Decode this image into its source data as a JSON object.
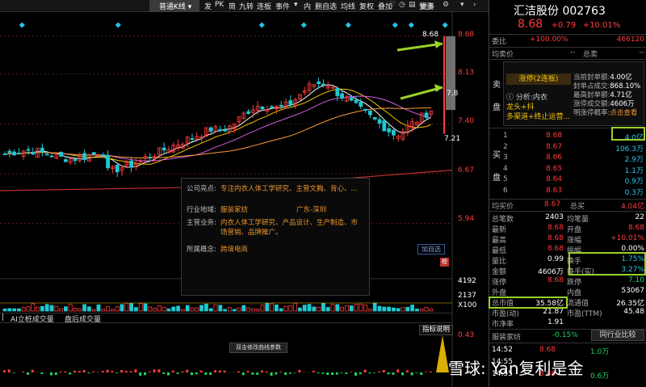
{
  "toolbar": {
    "kline_type": "普通K线",
    "items": [
      "发",
      "PK",
      "简",
      "九转",
      "连板",
      "事件",
      "▾",
      "内",
      "删自选",
      "均线",
      "复权",
      "叠加"
    ],
    "more": "更多",
    "icons": [
      "heart-icon",
      "clock-icon",
      "chart-icon",
      "edit-icon",
      "calendar-icon",
      "grid-icon"
    ]
  },
  "price_axis": [
    "8.68",
    "8.13",
    "7.40",
    "6.67",
    "5.94"
  ],
  "axis_current": "8.68",
  "marker_78": "7.8",
  "marker_721": "7.21",
  "volume_axis": [
    "4192",
    "2137",
    "X100"
  ],
  "indicator_tabs": [
    "AI立桩成交量",
    "盘后成交量"
  ],
  "indicator_button": "指标说明",
  "indicator_value": "0.43",
  "indicator_hint": "双击修改曲线参数",
  "add_favorite": "加自选",
  "popup": {
    "rows": [
      {
        "k": "公司亮点:",
        "v": "专注内衣人体工学研究、主营文胸、背心、..."
      },
      {
        "k": "行业地域:",
        "v": "服装家纺",
        "v2": "广东-深圳"
      },
      {
        "k": "主营业务:",
        "v": "内衣人体工学研究、产品设计、生产制造、市",
        "v3": "场营销、品牌推广。"
      },
      {
        "k": "所属概念:",
        "v": "跨境电商"
      }
    ]
  },
  "stock": {
    "name": "汇洁股份",
    "code": "002763",
    "price": "8.68",
    "change": "+0.79",
    "change_pct": "+10.01%"
  },
  "commission": {
    "label": "委比",
    "pct": "+100.00%",
    "diff": "466120"
  },
  "avg_price_label": "均卖价",
  "total_sell_label": "总卖",
  "limit": {
    "title": "涨停(2连板)",
    "analysis": "分析:内衣",
    "dragon": "龙头+抖",
    "channel": "多渠道+终止运营...",
    "stats": [
      {
        "k": "当前封单额:",
        "v": "4.00亿"
      },
      {
        "k": "封单占成交:",
        "v": "868.10%"
      },
      {
        "k": "最高封单额:",
        "v": "4.71亿"
      },
      {
        "k": "涨停成交额:",
        "v": "4606万"
      },
      {
        "k": "明涨停概率:",
        "v": "点击查看"
      }
    ]
  },
  "side_labels": {
    "sell": [
      "卖",
      "盘"
    ],
    "buy": [
      "买",
      "盘"
    ]
  },
  "bids": [
    {
      "n": "1",
      "p": "8.68",
      "v": "4.0亿"
    },
    {
      "n": "2",
      "p": "8.67",
      "v": "106.3万"
    },
    {
      "n": "3",
      "p": "8.66",
      "v": "2.9万"
    },
    {
      "n": "4",
      "p": "8.65",
      "v": "1.1万"
    },
    {
      "n": "5",
      "p": "8.64",
      "v": "0.9万"
    },
    {
      "n": "6",
      "p": "8.63",
      "v": "0.3万"
    }
  ],
  "bid_summary": {
    "k1": "均买价",
    "v1": "8.67",
    "k2": "总买",
    "v2": "4.04亿"
  },
  "stats": [
    {
      "k1": "总笔数",
      "v1": "2403",
      "k2": "均笔量",
      "v2": "22"
    },
    {
      "k1": "最新",
      "v1": "8.68",
      "k2": "开盘",
      "v2": "8.68"
    },
    {
      "k1": "最高",
      "v1": "8.68",
      "k2": "涨幅",
      "v2": "+10.01%"
    },
    {
      "k1": "最低",
      "v1": "8.68",
      "k2": "振幅",
      "v2": "0.00%"
    },
    {
      "k1": "量比",
      "v1": "0.99",
      "k2": "换手",
      "v2": "1.75%"
    },
    {
      "k1": "金额",
      "v1": "4606万",
      "k2": "换手(实)",
      "v2": "3.27%"
    },
    {
      "k1": "涨停",
      "v1": "8.68",
      "k2": "跌停",
      "v2": "7.10"
    },
    {
      "k1": "外盘",
      "v1": "",
      "k2": "内盘",
      "v2": "53067"
    },
    {
      "k1": "总市值",
      "v1": "35.58亿",
      "k2": "流通值",
      "v2": "26.35亿"
    },
    {
      "k1": "市盈(动)",
      "v1": "21.87",
      "k2": "市盈(TTM)",
      "v2": "45.48"
    },
    {
      "k1": "市净率",
      "v1": "1.91",
      "k2": "",
      "v2": ""
    }
  ],
  "industry": {
    "name": "服装家纺",
    "pct": "-0.15%",
    "button": "同行业比较"
  },
  "ticks": [
    {
      "t": "14:52",
      "p": "8.68",
      "v": "1.0万"
    },
    {
      "t": "14:55",
      "p": "",
      "v": ""
    },
    {
      "t": "14:55",
      "p": "8.68",
      "v": "0.6万"
    }
  ],
  "watermark": "雪球: Yan复利是金",
  "chart_data": {
    "type": "candlestick",
    "ylim": [
      5.9,
      8.7
    ],
    "colors": {
      "up": "#ff3b3b",
      "down": "#1ec8d0",
      "ma5": "#ffffff",
      "ma10": "#f2c200",
      "ma20": "#d05ee0",
      "ma60": "#ff9a3c",
      "ma120": "#c43030"
    }
  }
}
